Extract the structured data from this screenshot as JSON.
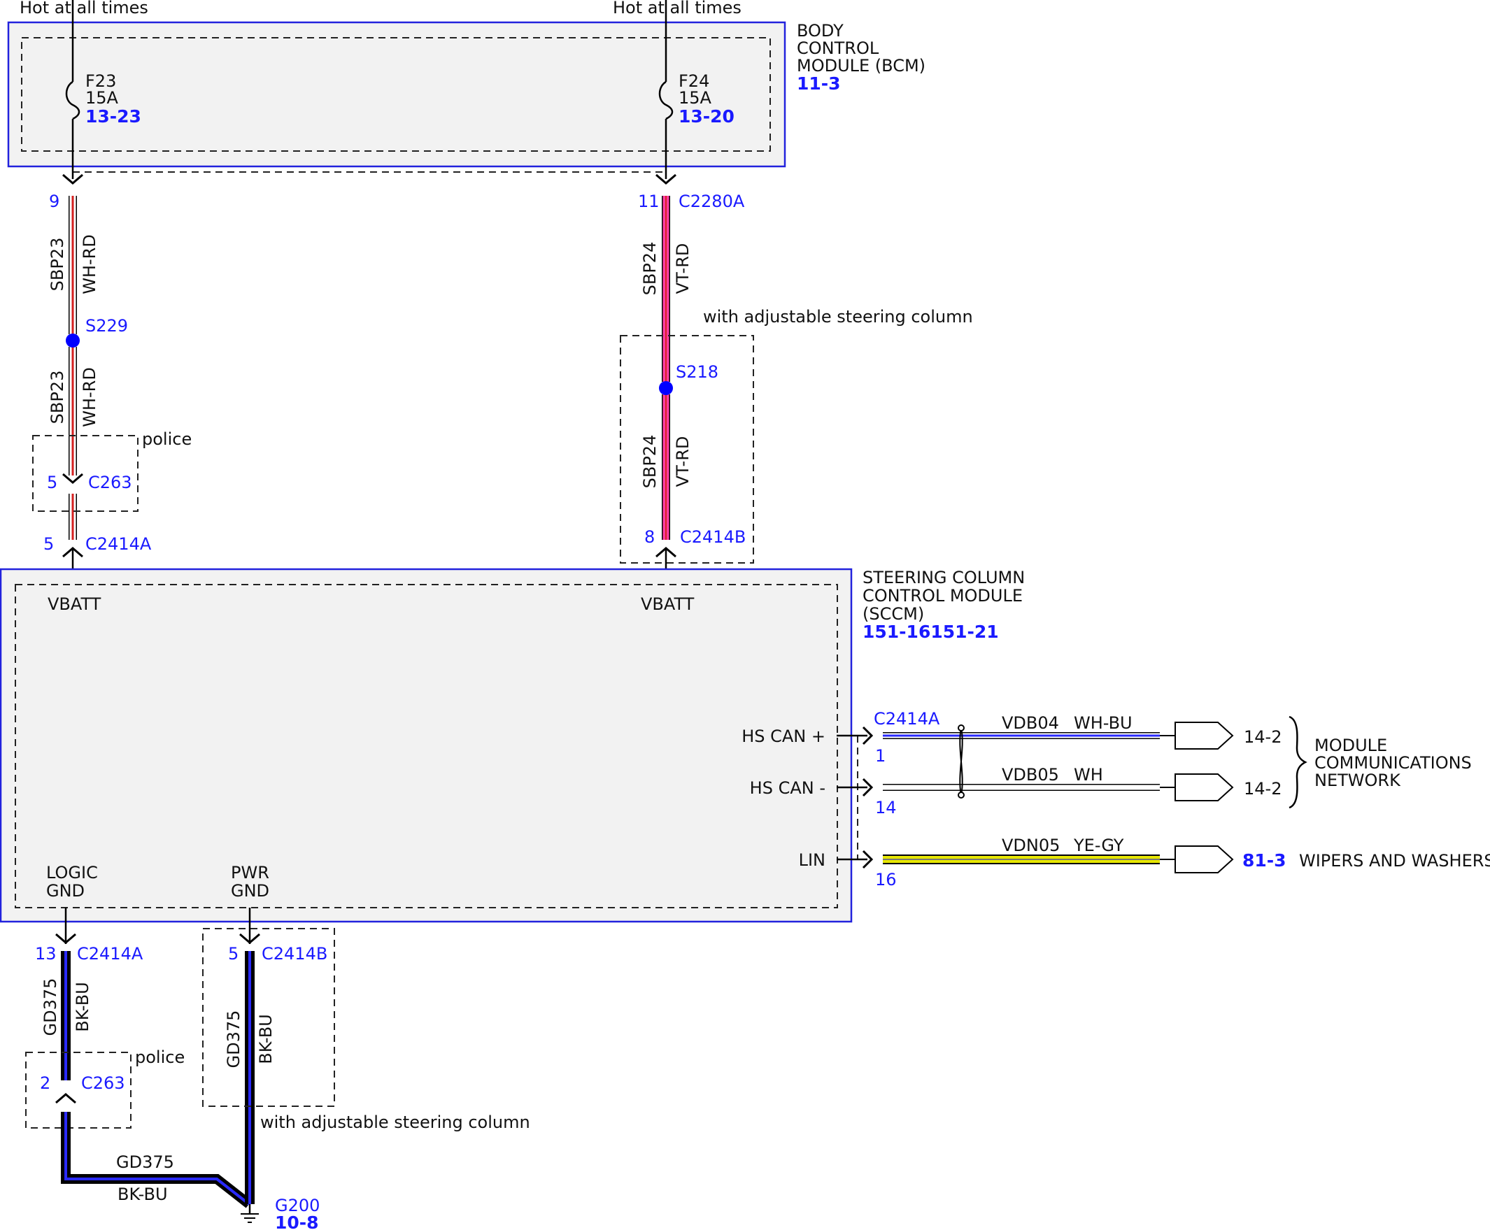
{
  "colors": {
    "module_outline": "#2222dd",
    "module_fill": "#f2f2f2",
    "label_blue": "#1a1aff",
    "wire_red": "#d42020",
    "wire_violet": "#ff3ca0",
    "wire_blue": "#2a2aff",
    "wire_black": "#000000",
    "wire_yellow": "#e6e600",
    "splice": "#0000ff"
  },
  "power": {
    "left_source": "Hot at all times",
    "right_source": "Hot at all times"
  },
  "bcm": {
    "title_line1": "BODY",
    "title_line2": "CONTROL",
    "title_line3": "MODULE (BCM)",
    "ref": "11-3",
    "fuse_left": {
      "name": "F23",
      "rating": "15A",
      "ref": "13-23"
    },
    "fuse_right": {
      "name": "F24",
      "rating": "15A",
      "ref": "13-20"
    }
  },
  "left_branch": {
    "pin_top": "9",
    "wire1_circuit": "SBP23",
    "wire1_color": "WH-RD",
    "splice": "S229",
    "wire2_circuit": "SBP23",
    "wire2_color": "WH-RD",
    "option_label": "police",
    "inline_pin": "5",
    "inline_connector": "C263",
    "module_pin": "5",
    "module_connector": "C2414A"
  },
  "right_branch": {
    "pin_top": "11",
    "connector_top": "C2280A",
    "wire1_circuit": "SBP24",
    "wire1_color": "VT-RD",
    "option_label": "with adjustable steering column",
    "splice": "S218",
    "wire2_circuit": "SBP24",
    "wire2_color": "VT-RD",
    "module_pin": "8",
    "module_connector": "C2414B"
  },
  "sccm": {
    "title_line1": "STEERING COLUMN",
    "title_line2": "CONTROL MODULE",
    "title_line3": "(SCCM)",
    "ref": "151-16151-21",
    "vbatt_left": "VBATT",
    "vbatt_right": "VBATT",
    "hs_can_plus": "HS CAN +",
    "hs_can_minus": "HS CAN -",
    "lin": "LIN",
    "logic_gnd_line1": "LOGIC",
    "logic_gnd_line2": "GND",
    "pwr_gnd_line1": "PWR",
    "pwr_gnd_line2": "GND"
  },
  "network": {
    "connector": "C2414A",
    "can_plus": {
      "pin": "1",
      "circuit": "VDB04",
      "color": "WH-BU",
      "dest": "14-2"
    },
    "can_minus": {
      "pin": "14",
      "circuit": "VDB05",
      "color": "WH",
      "dest": "14-2"
    },
    "lin": {
      "pin": "16",
      "circuit": "VDN05",
      "color": "YE-GY",
      "dest": "81-3"
    },
    "group_line1": "MODULE",
    "group_line2": "COMMUNICATIONS",
    "group_line3": "NETWORK",
    "lin_target": "WIPERS AND WASHERS"
  },
  "ground_left": {
    "pin_top": "13",
    "connector_top": "C2414A",
    "wire_circuit": "GD375",
    "wire_color": "BK-BU",
    "option_label": "police",
    "inline_pin": "2",
    "inline_connector": "C263",
    "bottom_circuit": "GD375",
    "bottom_color": "BK-BU"
  },
  "ground_right": {
    "pin_top": "5",
    "connector_top": "C2414B",
    "wire_circuit": "GD375",
    "wire_color": "BK-BU",
    "option_label": "with adjustable steering column"
  },
  "ground": {
    "name": "G200",
    "ref": "10-8"
  }
}
